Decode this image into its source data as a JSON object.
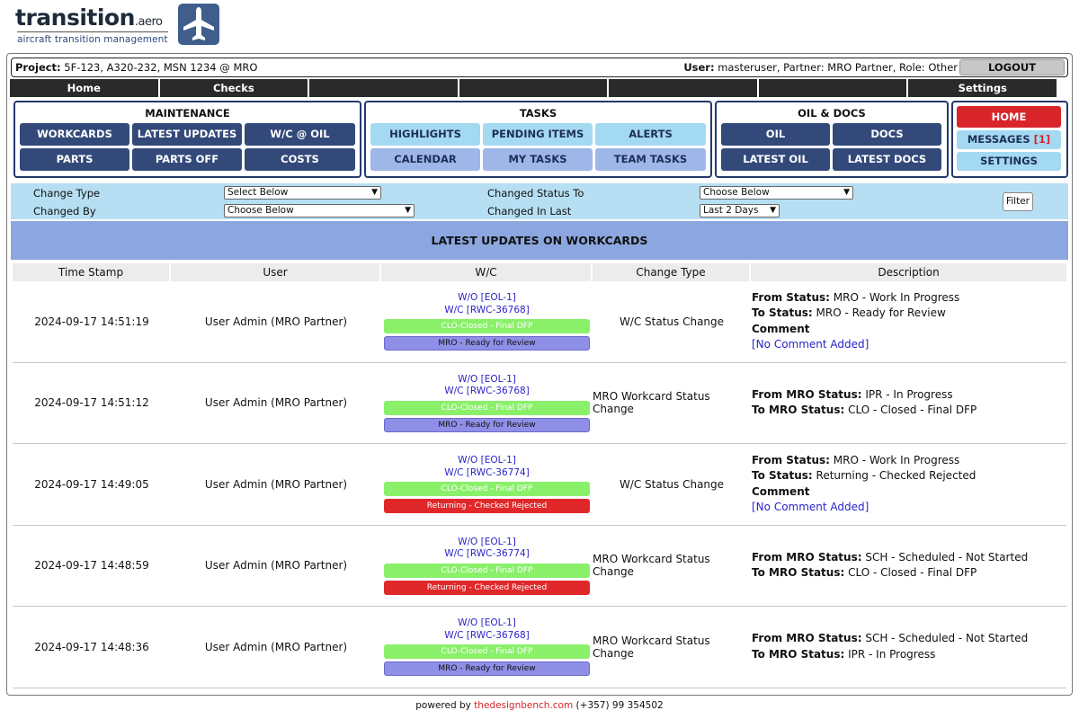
{
  "logo": {
    "name": "transition",
    "suffix": ".aero",
    "tagline": "aircraft transition management"
  },
  "project_bar": {
    "project_label": "Project:",
    "project_value": " 5F-123, A320-232, MSN 1234 @ MRO",
    "user_label": "User:",
    "user_value": " masteruser, Partner: MRO Partner, Role: Other",
    "logout_label": "LOGOUT"
  },
  "nav": [
    "Home",
    "Checks",
    "",
    "",
    "",
    "",
    "Settings"
  ],
  "panels": {
    "maintenance": {
      "title": "MAINTENANCE",
      "buttons": [
        "WORKCARDS",
        "LATEST UPDATES",
        "W/C @ OIL",
        "PARTS",
        "PARTS OFF",
        "COSTS"
      ]
    },
    "tasks": {
      "title": "TASKS",
      "buttons": [
        "HIGHLIGHTS",
        "PENDING ITEMS",
        "ALERTS",
        "CALENDAR",
        "MY TASKS",
        "TEAM TASKS"
      ]
    },
    "oil_docs": {
      "title": "OIL & DOCS",
      "buttons": [
        "OIL",
        "DOCS",
        "LATEST OIL",
        "LATEST DOCS"
      ]
    },
    "side": {
      "home": "HOME",
      "messages": "MESSAGES ",
      "messages_count": "[1]",
      "settings": "SETTINGS"
    }
  },
  "filters": {
    "change_type_label": "Change Type",
    "change_type_value": "Select Below",
    "changed_by_label": "Changed By",
    "changed_by_value": "Choose Below",
    "changed_status_label": "Changed Status To",
    "changed_status_value": "Choose Below",
    "changed_in_last_label": "Changed In Last",
    "changed_in_last_value": "Last 2 Days",
    "filter_button": "Filter"
  },
  "table_title": "LATEST UPDATES ON WORKCARDS",
  "columns": [
    "Time Stamp",
    "User",
    "W/C",
    "Change Type",
    "Description"
  ],
  "rows": [
    {
      "time": "2024-09-17 14:51:19",
      "user": "User Admin (MRO Partner)",
      "wo": "W/O [EOL-1]",
      "wc": "W/C [RWC-36768]",
      "tag1": "CLO-Closed - Final DFP",
      "tag2": "MRO - Ready for Review",
      "change_type": "W/C Status Change",
      "d1_label": "From Status:",
      "d1_value": " MRO - Work In Progress",
      "d2_label": "To Status:",
      "d2_value": " MRO - Ready for Review",
      "d3_label": "Comment",
      "d4_link": "[No Comment Added]"
    },
    {
      "time": "2024-09-17 14:51:12",
      "user": "User Admin (MRO Partner)",
      "wo": "W/O [EOL-1]",
      "wc": "W/C [RWC-36768]",
      "tag1": "CLO-Closed - Final DFP",
      "tag2": "MRO - Ready for Review",
      "change_type": "MRO Workcard Status Change",
      "d1_label": "From MRO Status:",
      "d1_value": " IPR - In Progress",
      "d2_label": "To MRO Status:",
      "d2_value": " CLO - Closed - Final DFP"
    },
    {
      "time": "2024-09-17 14:49:05",
      "user": "User Admin (MRO Partner)",
      "wo": "W/O [EOL-1]",
      "wc": "W/C [RWC-36774]",
      "tag1": "CLO-Closed - Final DFP",
      "tag2": "Returning - Checked Rejected",
      "change_type": "W/C Status Change",
      "d1_label": "From Status:",
      "d1_value": " MRO - Work In Progress",
      "d2_label": "To Status:",
      "d2_value": " Returning - Checked Rejected",
      "d3_label": "Comment",
      "d4_link": "[No Comment Added]"
    },
    {
      "time": "2024-09-17 14:48:59",
      "user": "User Admin (MRO Partner)",
      "wo": "W/O [EOL-1]",
      "wc": "W/C [RWC-36774]",
      "tag1": "CLO-Closed - Final DFP",
      "tag2": "Returning - Checked Rejected",
      "change_type": "MRO Workcard Status Change",
      "d1_label": "From MRO Status:",
      "d1_value": " SCH - Scheduled - Not Started",
      "d2_label": "To MRO Status:",
      "d2_value": " CLO - Closed - Final DFP"
    },
    {
      "time": "2024-09-17 14:48:36",
      "user": "User Admin (MRO Partner)",
      "wo": "W/O [EOL-1]",
      "wc": "W/C [RWC-36768]",
      "tag1": "CLO-Closed - Final DFP",
      "tag2": "MRO - Ready for Review",
      "change_type": "MRO Workcard Status Change",
      "d1_label": "From MRO Status:",
      "d1_value": " SCH - Scheduled - Not Started",
      "d2_label": "To MRO Status:",
      "d2_value": " IPR - In Progress"
    }
  ],
  "footer": {
    "prefix": "powered by ",
    "brand": "thedesignbench.com",
    "phone": " (+357) 99 354502"
  },
  "colors": {
    "navy": "#33497a",
    "light_blue": "#a4d9f2",
    "title_band": "#8ca7e0",
    "red": "#d8252a",
    "green_tag": "#8af06a",
    "purple_tag": "#8f8fe8"
  }
}
